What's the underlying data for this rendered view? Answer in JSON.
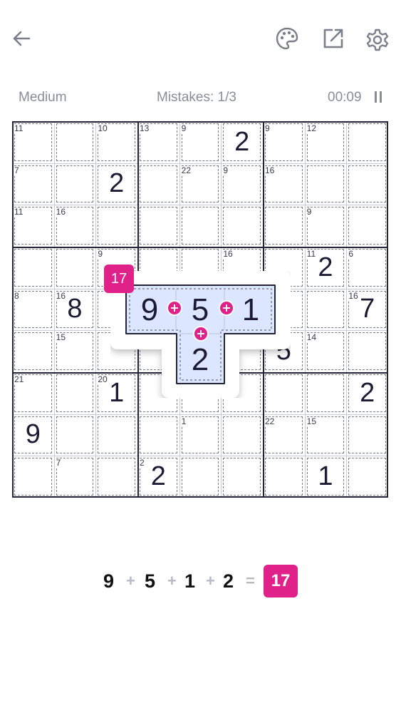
{
  "header": {
    "back_icon": "arrow-left-icon",
    "theme_icon": "palette-icon",
    "share_icon": "external-link-icon",
    "settings_icon": "gear-icon",
    "icon_color": "#7b7f8c"
  },
  "status": {
    "difficulty": "Medium",
    "mistakes": "Mistakes: 1/3",
    "timer": "00:09",
    "pause_icon": "pause-icon"
  },
  "colors": {
    "accent": "#e0218a",
    "cage_highlight": "#dde6ff",
    "cage_outline": "#23233a"
  },
  "board": {
    "values": [
      {
        "r": 0,
        "c": 5,
        "v": "2"
      },
      {
        "r": 1,
        "c": 2,
        "v": "2"
      },
      {
        "r": 3,
        "c": 7,
        "v": "2"
      },
      {
        "r": 4,
        "c": 1,
        "v": "8"
      },
      {
        "r": 4,
        "c": 8,
        "v": "7"
      },
      {
        "r": 5,
        "c": 6,
        "v": "5"
      },
      {
        "r": 6,
        "c": 2,
        "v": "1"
      },
      {
        "r": 6,
        "c": 8,
        "v": "2"
      },
      {
        "r": 7,
        "c": 0,
        "v": "9"
      },
      {
        "r": 8,
        "c": 3,
        "v": "2"
      },
      {
        "r": 8,
        "c": 7,
        "v": "1"
      }
    ],
    "cage_sums": [
      {
        "r": 0,
        "c": 0,
        "s": "11"
      },
      {
        "r": 0,
        "c": 2,
        "s": "10"
      },
      {
        "r": 0,
        "c": 3,
        "s": "13"
      },
      {
        "r": 0,
        "c": 4,
        "s": "9"
      },
      {
        "r": 0,
        "c": 6,
        "s": "9"
      },
      {
        "r": 0,
        "c": 7,
        "s": "12"
      },
      {
        "r": 1,
        "c": 0,
        "s": "7"
      },
      {
        "r": 1,
        "c": 4,
        "s": "22"
      },
      {
        "r": 1,
        "c": 5,
        "s": "9"
      },
      {
        "r": 1,
        "c": 6,
        "s": "16"
      },
      {
        "r": 2,
        "c": 0,
        "s": "11"
      },
      {
        "r": 2,
        "c": 1,
        "s": "16"
      },
      {
        "r": 2,
        "c": 7,
        "s": "9"
      },
      {
        "r": 3,
        "c": 2,
        "s": "9"
      },
      {
        "r": 3,
        "c": 5,
        "s": "16"
      },
      {
        "r": 3,
        "c": 7,
        "s": "11"
      },
      {
        "r": 3,
        "c": 8,
        "s": "6"
      },
      {
        "r": 4,
        "c": 0,
        "s": "8"
      },
      {
        "r": 4,
        "c": 1,
        "s": "16"
      },
      {
        "r": 4,
        "c": 8,
        "s": "16"
      },
      {
        "r": 5,
        "c": 1,
        "s": "15"
      },
      {
        "r": 5,
        "c": 7,
        "s": "14"
      },
      {
        "r": 6,
        "c": 0,
        "s": "21"
      },
      {
        "r": 6,
        "c": 2,
        "s": "20"
      },
      {
        "r": 7,
        "c": 4,
        "s": "1"
      },
      {
        "r": 7,
        "c": 6,
        "s": "22"
      },
      {
        "r": 7,
        "c": 7,
        "s": "15"
      },
      {
        "r": 8,
        "c": 1,
        "s": "7"
      },
      {
        "r": 8,
        "c": 3,
        "s": "2"
      }
    ]
  },
  "highlight_cage": {
    "sum": "17",
    "values": [
      "9",
      "5",
      "1",
      "2"
    ]
  },
  "equation": {
    "terms": [
      "9",
      "5",
      "1",
      "2"
    ],
    "plus": "+",
    "equals": "=",
    "result": "17"
  }
}
